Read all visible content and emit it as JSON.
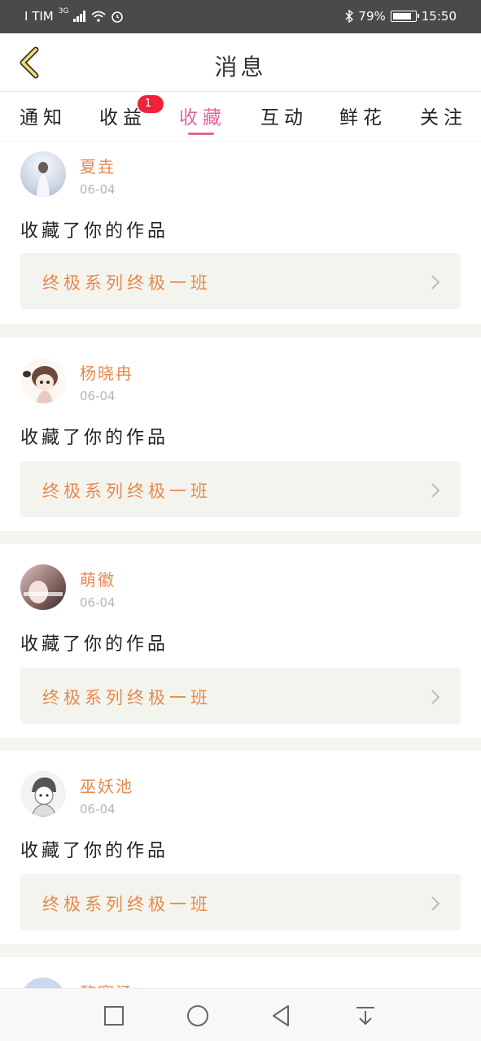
{
  "status_bar": {
    "carrier": "I TIM",
    "network": "3G",
    "battery": "79%",
    "time": "15:50"
  },
  "header": {
    "title": "消息"
  },
  "tabs": [
    {
      "label": "通知"
    },
    {
      "label": "收益",
      "badge": "1"
    },
    {
      "label": "收藏",
      "active": true
    },
    {
      "label": "互动"
    },
    {
      "label": "鲜花"
    },
    {
      "label": "关注"
    }
  ],
  "items": [
    {
      "user": "夏垚",
      "date": "06-04",
      "action": "收藏了你的作品",
      "work": "终极系列终极一班"
    },
    {
      "user": "杨晓冉",
      "date": "06-04",
      "action": "收藏了你的作品",
      "work": "终极系列终极一班"
    },
    {
      "user": "萌徽",
      "date": "06-04",
      "action": "收藏了你的作品",
      "work": "终极系列终极一班"
    },
    {
      "user": "巫妖池",
      "date": "06-04",
      "action": "收藏了你的作品",
      "work": "终极系列终极一班"
    },
    {
      "user": "黎寒汤",
      "date": "",
      "action": "",
      "work": ""
    }
  ],
  "colors": {
    "accent": "#e0679b",
    "username": "#e58a4e",
    "badge": "#f0213a"
  }
}
